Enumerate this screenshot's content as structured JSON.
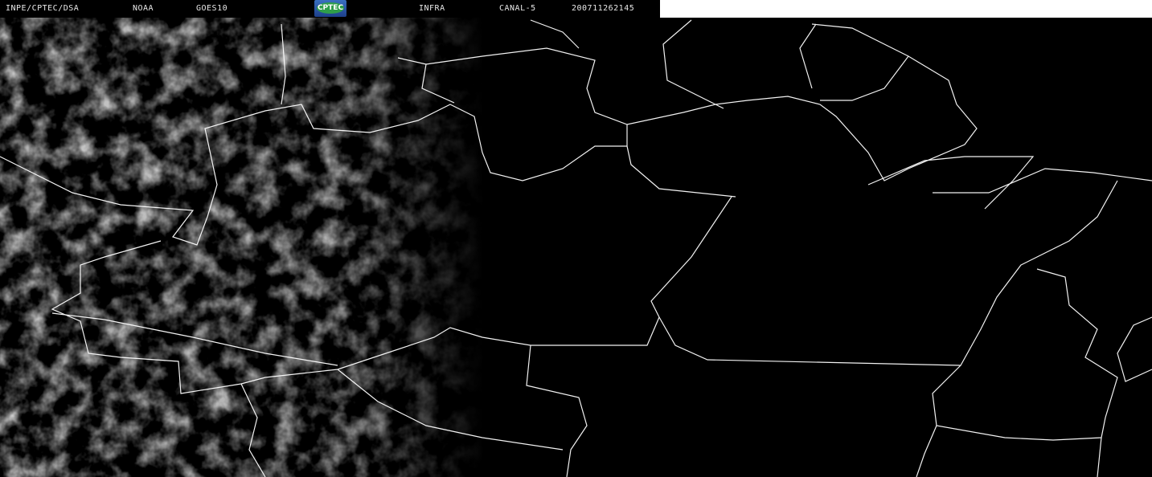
{
  "header": {
    "agency": "INPE/CPTEC/DSA",
    "operator": "NOAA",
    "satellite": "GOES10",
    "logo_text": "CPTEC",
    "product": "INFRA",
    "channel": "CANAL-5",
    "timestamp": "200711262145"
  },
  "colors": {
    "background": "#000000",
    "borders": "#ffffff",
    "clouds": "#9a9a9a"
  }
}
